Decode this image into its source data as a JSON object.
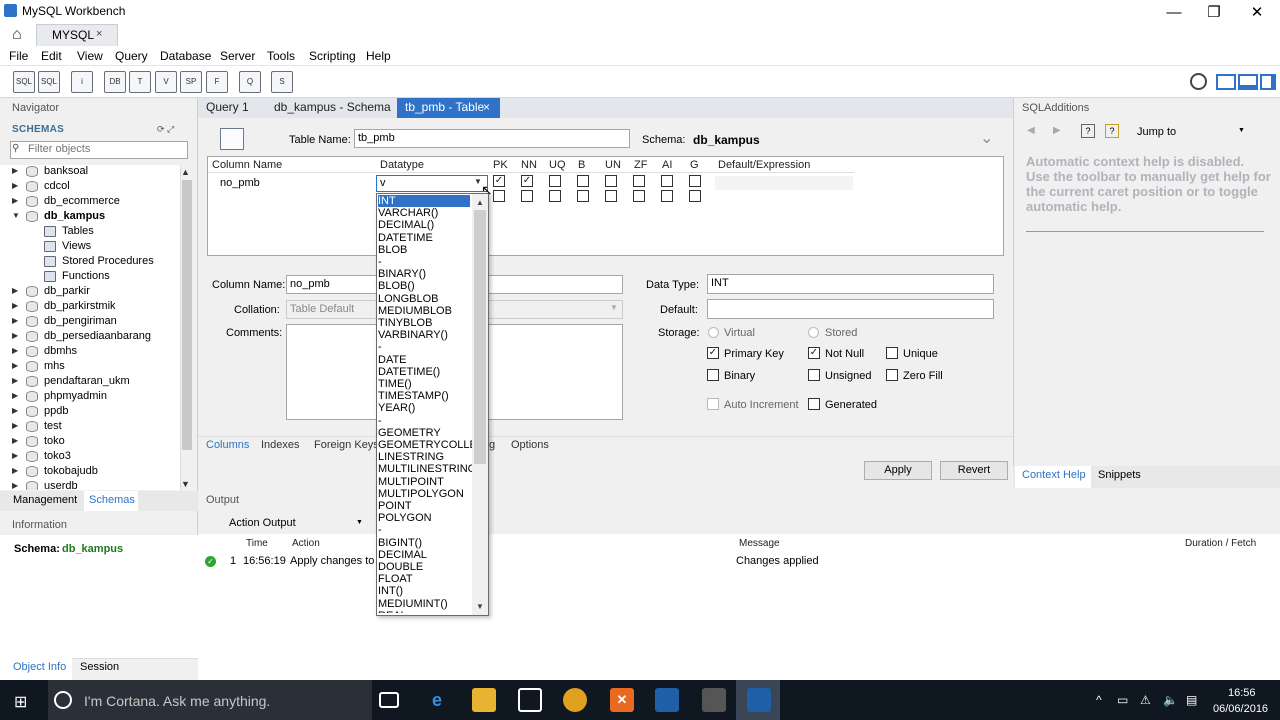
{
  "window": {
    "title": "MySQL Workbench",
    "minimize": "—",
    "maximize": "❐",
    "close": "✕"
  },
  "connection_tab": {
    "label": "MYSQL",
    "close": "×"
  },
  "menu": [
    "File",
    "Edit",
    "View",
    "Query",
    "Database",
    "Server",
    "Tools",
    "Scripting",
    "Help"
  ],
  "toolbar": [
    "SQL",
    "SQL",
    "i",
    "DB",
    "T",
    "V",
    "SP",
    "F",
    "Q",
    "S"
  ],
  "navigator": {
    "title": "Navigator",
    "schemas_header": "SCHEMAS",
    "filter_placeholder": "Filter objects",
    "schemas": [
      {
        "name": "banksoal",
        "expanded": false
      },
      {
        "name": "cdcol",
        "expanded": false
      },
      {
        "name": "db_ecommerce",
        "expanded": false
      },
      {
        "name": "db_kampus",
        "expanded": true,
        "bold": true
      },
      {
        "name": "Tables",
        "child": true
      },
      {
        "name": "Views",
        "child": true
      },
      {
        "name": "Stored Procedures",
        "child": true
      },
      {
        "name": "Functions",
        "child": true
      },
      {
        "name": "db_parkir",
        "expanded": false
      },
      {
        "name": "db_parkirstmik",
        "expanded": false
      },
      {
        "name": "db_pengiriman",
        "expanded": false
      },
      {
        "name": "db_persediaanbarang",
        "expanded": false
      },
      {
        "name": "dbmhs",
        "expanded": false
      },
      {
        "name": "mhs",
        "expanded": false
      },
      {
        "name": "pendaftaran_ukm",
        "expanded": false
      },
      {
        "name": "phpmyadmin",
        "expanded": false
      },
      {
        "name": "ppdb",
        "expanded": false
      },
      {
        "name": "test",
        "expanded": false
      },
      {
        "name": "toko",
        "expanded": false
      },
      {
        "name": "toko3",
        "expanded": false
      },
      {
        "name": "tokobajudb",
        "expanded": false
      },
      {
        "name": "userdb",
        "expanded": false
      }
    ],
    "tabs": [
      "Management",
      "Schemas"
    ],
    "info_title": "Information",
    "info_schema_label": "Schema:",
    "info_schema_value": "db_kampus",
    "bottom_tabs": [
      "Object Info",
      "Session"
    ]
  },
  "editor_tabs": [
    {
      "label": "Query 1"
    },
    {
      "label": "db_kampus - Schema"
    },
    {
      "label": "tb_pmb - Table",
      "close": "×",
      "active": true
    }
  ],
  "table_editor": {
    "table_name_label": "Table Name:",
    "table_name": "tb_pmb",
    "schema_label": "Schema:",
    "schema_value": "db_kampus",
    "collapse_icon": "⌄",
    "grid_headers": [
      "Column Name",
      "Datatype",
      "PK",
      "NN",
      "UQ",
      "B",
      "UN",
      "ZF",
      "AI",
      "G",
      "Default/Expression"
    ],
    "row": {
      "column_name": "no_pmb",
      "datatype_input": "v"
    },
    "column_name_label": "Column Name:",
    "column_name_value": "no_pmb",
    "collation_label": "Collation:",
    "collation_value": "Table Default",
    "comments_label": "Comments:",
    "data_type_label": "Data Type:",
    "data_type_value": "INT",
    "default_label": "Default:",
    "storage_label": "Storage:",
    "storage_virtual": "Virtual",
    "storage_stored": "Stored",
    "options": {
      "primary_key": "Primary Key",
      "not_null": "Not Null",
      "unique": "Unique",
      "binary": "Binary",
      "unsigned": "Unsigned",
      "zero_fill": "Zero Fill",
      "auto_increment": "Auto Increment",
      "generated": "Generated"
    },
    "bottom_tabs": [
      "Columns",
      "Indexes",
      "Foreign Keys",
      "g",
      "Options"
    ],
    "apply": "Apply",
    "revert": "Revert"
  },
  "datatype_dropdown": [
    "INT",
    "VARCHAR()",
    "DECIMAL()",
    "DATETIME",
    "BLOB",
    "-",
    "BINARY()",
    "BLOB()",
    "LONGBLOB",
    "MEDIUMBLOB",
    "TINYBLOB",
    "VARBINARY()",
    "-",
    "DATE",
    "DATETIME()",
    "TIME()",
    "TIMESTAMP()",
    "YEAR()",
    "-",
    "GEOMETRY",
    "GEOMETRYCOLLECTION",
    "LINESTRING",
    "MULTILINESTRING",
    "MULTIPOINT",
    "MULTIPOLYGON",
    "POINT",
    "POLYGON",
    "-",
    "BIGINT()",
    "DECIMAL",
    "DOUBLE",
    "FLOAT",
    "INT()",
    "MEDIUMINT()",
    "REAL"
  ],
  "sql_additions": {
    "title": "SQLAdditions",
    "jump_to": "Jump to",
    "help": "Automatic context help is disabled. Use the toolbar to manually get help for the current caret position or to toggle automatic help.",
    "tabs": [
      "Context Help",
      "Snippets"
    ]
  },
  "output": {
    "title": "Output",
    "selector": "Action Output",
    "headers": [
      "Time",
      "Action",
      "Message",
      "Duration / Fetch"
    ],
    "rows": [
      {
        "num": "1",
        "time": "16:56:19",
        "action": "Apply changes to db",
        "message": "Changes applied"
      }
    ]
  },
  "taskbar": {
    "cortana": "I'm Cortana. Ask me anything.",
    "time": "16:56",
    "date": "06/06/2016"
  },
  "colors": {
    "accent": "#2f72c8",
    "schema_green": "#1e7a1e",
    "taskbar": "#0f1720"
  }
}
